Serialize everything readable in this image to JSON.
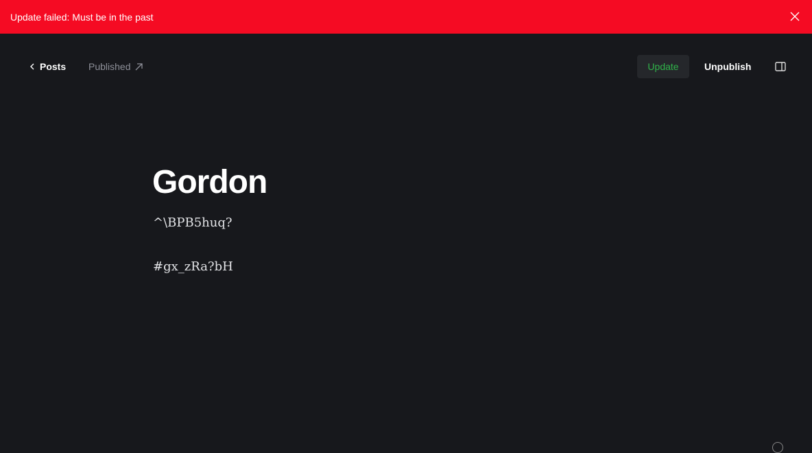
{
  "banner": {
    "message": "Update failed: Must be in the past"
  },
  "nav": {
    "back_label": "Posts",
    "status_label": "Published",
    "update_label": "Update",
    "unpublish_label": "Unpublish"
  },
  "post": {
    "title": "Gordon",
    "paragraphs": [
      "^\\BPB5huq?",
      "#gx_zRa?bH"
    ]
  },
  "colors": {
    "banner": "#f50b23",
    "update_text": "#30b44a",
    "background": "#17181c"
  }
}
